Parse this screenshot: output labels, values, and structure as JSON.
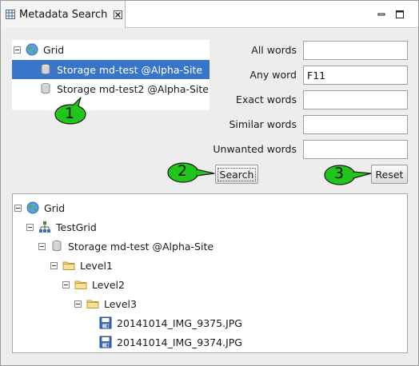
{
  "view": {
    "title": "Metadata Search",
    "tab_icon": "grid-view-icon",
    "close_icon": "close-icon",
    "minimize_icon": "minimize-icon",
    "maximize_icon": "maximize-icon"
  },
  "source_tree": {
    "root": {
      "label": "Grid",
      "icon": "globe-icon",
      "expanded": true
    },
    "storages": [
      {
        "label": "Storage md-test @Alpha-Site",
        "icon": "storage-icon",
        "selected": true
      },
      {
        "label": "Storage md-test2 @Alpha-Site",
        "icon": "storage-icon",
        "selected": false
      }
    ]
  },
  "search_form": {
    "fields": [
      {
        "label": "All words",
        "value": ""
      },
      {
        "label": "Any word",
        "value": "F11"
      },
      {
        "label": "Exact words",
        "value": ""
      },
      {
        "label": "Similar words",
        "value": ""
      },
      {
        "label": "Unwanted words",
        "value": ""
      }
    ],
    "search_label": "Search",
    "reset_label": "Reset"
  },
  "results_tree": {
    "root": {
      "label": "Grid",
      "icon": "globe-icon"
    },
    "grid": {
      "label": "TestGrid",
      "icon": "network-icon"
    },
    "storage": {
      "label": "Storage md-test @Alpha-Site",
      "icon": "storage-icon"
    },
    "level1": {
      "label": "Level1",
      "icon": "folder-icon"
    },
    "level2": {
      "label": "Level2",
      "icon": "folder-icon"
    },
    "level3": {
      "label": "Level3",
      "icon": "folder-icon"
    },
    "files": [
      {
        "label": "20141014_IMG_9375.JPG",
        "icon": "file-icon"
      },
      {
        "label": "20141014_IMG_9374.JPG",
        "icon": "file-icon"
      }
    ]
  },
  "callouts": [
    {
      "number": "1",
      "color": "#22c51c"
    },
    {
      "number": "2",
      "color": "#22c51c"
    },
    {
      "number": "3",
      "color": "#22c51c"
    }
  ],
  "colors": {
    "selection": "#3875c9",
    "callout_green": "#22c51c"
  }
}
